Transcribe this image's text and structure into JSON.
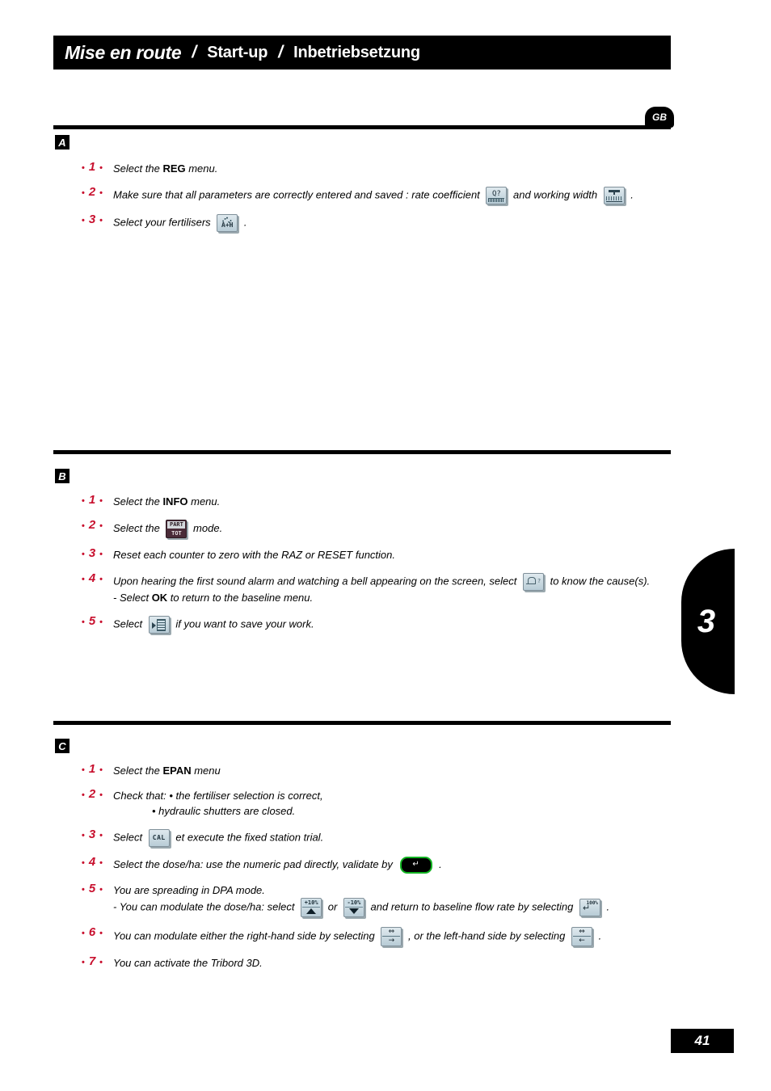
{
  "header": {
    "title_fr": "Mise en route",
    "separator": "/",
    "title_en": "Start-up",
    "title_de": "Inbetriebsetzung"
  },
  "language_badge": "GB",
  "chapter_tab": "3",
  "page_number": "41",
  "sections": [
    {
      "letter": "A",
      "steps": [
        {
          "num": "1",
          "lines": [
            {
              "parts": [
                {
                  "t": "text",
                  "v": "Select the "
                },
                {
                  "t": "bold",
                  "v": "REG"
                },
                {
                  "t": "text",
                  "v": " menu."
                }
              ]
            }
          ]
        },
        {
          "num": "2",
          "lines": [
            {
              "parts": [
                {
                  "t": "text",
                  "v": "Make sure that all parameters are correctly entered and saved : rate coefficient "
                },
                {
                  "t": "icon",
                  "v": "rate-coefficient-key"
                },
                {
                  "t": "text",
                  "v": " and working width "
                },
                {
                  "t": "icon",
                  "v": "working-width-key"
                },
                {
                  "t": "text",
                  "v": " ."
                }
              ]
            }
          ]
        },
        {
          "num": "3",
          "lines": [
            {
              "parts": [
                {
                  "t": "text",
                  "v": "Select your fertilisers "
                },
                {
                  "t": "icon",
                  "v": "fertiliser-key"
                },
                {
                  "t": "text",
                  "v": " ."
                }
              ]
            }
          ]
        }
      ]
    },
    {
      "letter": "B",
      "steps": [
        {
          "num": "1",
          "lines": [
            {
              "parts": [
                {
                  "t": "text",
                  "v": "Select the "
                },
                {
                  "t": "bold",
                  "v": "INFO"
                },
                {
                  "t": "text",
                  "v": " menu."
                }
              ]
            }
          ]
        },
        {
          "num": "2",
          "lines": [
            {
              "parts": [
                {
                  "t": "text",
                  "v": "Select the "
                },
                {
                  "t": "icon",
                  "v": "part-tot-key"
                },
                {
                  "t": "text",
                  "v": " mode."
                }
              ]
            }
          ]
        },
        {
          "num": "3",
          "lines": [
            {
              "parts": [
                {
                  "t": "text",
                  "v": "Reset each counter to zero with the RAZ or RESET function."
                }
              ]
            }
          ]
        },
        {
          "num": "4",
          "lines": [
            {
              "parts": [
                {
                  "t": "text",
                  "v": "Upon hearing the first sound alarm and watching a bell appearing on the screen, select "
                },
                {
                  "t": "icon",
                  "v": "alarm-bell-key"
                },
                {
                  "t": "text",
                  "v": " to know the cause(s)."
                }
              ]
            },
            {
              "parts": [
                {
                  "t": "text",
                  "v": "- Select "
                },
                {
                  "t": "bold",
                  "v": "OK"
                },
                {
                  "t": "text",
                  "v": " to return to the baseline menu."
                }
              ]
            }
          ]
        },
        {
          "num": "5",
          "lines": [
            {
              "parts": [
                {
                  "t": "text",
                  "v": "Select "
                },
                {
                  "t": "icon",
                  "v": "save-work-key"
                },
                {
                  "t": "text",
                  "v": " if you want to save your work."
                }
              ]
            }
          ]
        }
      ]
    },
    {
      "letter": "C",
      "steps": [
        {
          "num": "1",
          "lines": [
            {
              "parts": [
                {
                  "t": "text",
                  "v": "Select the "
                },
                {
                  "t": "bold",
                  "v": "EPAN"
                },
                {
                  "t": "text",
                  "v": " menu"
                }
              ]
            }
          ]
        },
        {
          "num": "2",
          "lines": [
            {
              "parts": [
                {
                  "t": "text",
                  "v": "Check that: • the fertiliser selection is correct,"
                }
              ]
            },
            {
              "indent": true,
              "parts": [
                {
                  "t": "text",
                  "v": "• hydraulic shutters are closed."
                }
              ]
            }
          ]
        },
        {
          "num": "3",
          "lines": [
            {
              "parts": [
                {
                  "t": "text",
                  "v": "Select "
                },
                {
                  "t": "icon",
                  "v": "cal-key"
                },
                {
                  "t": "text",
                  "v": " et execute the fixed station trial."
                }
              ]
            }
          ]
        },
        {
          "num": "4",
          "lines": [
            {
              "parts": [
                {
                  "t": "text",
                  "v": "Select the dose/ha: use the numeric pad directly, validate by "
                },
                {
                  "t": "icon",
                  "v": "validate-enter-key"
                },
                {
                  "t": "text",
                  "v": " ."
                }
              ]
            }
          ]
        },
        {
          "num": "5",
          "lines": [
            {
              "parts": [
                {
                  "t": "text",
                  "v": "You are spreading in DPA mode."
                }
              ]
            },
            {
              "parts": [
                {
                  "t": "text",
                  "v": "- You can modulate the dose/ha: select "
                },
                {
                  "t": "icon",
                  "v": "plus-10-percent-key"
                },
                {
                  "t": "text",
                  "v": " or "
                },
                {
                  "t": "icon",
                  "v": "minus-10-percent-key"
                },
                {
                  "t": "text",
                  "v": " and return to baseline flow rate by selecting "
                },
                {
                  "t": "icon",
                  "v": "return-100-percent-key"
                },
                {
                  "t": "text",
                  "v": " ."
                }
              ]
            }
          ]
        },
        {
          "num": "6",
          "lines": [
            {
              "parts": [
                {
                  "t": "text",
                  "v": "You can modulate either the right-hand side by selecting "
                },
                {
                  "t": "icon",
                  "v": "modulate-right-side-key"
                },
                {
                  "t": "text",
                  "v": " , or the left-hand side by selecting "
                },
                {
                  "t": "icon",
                  "v": "modulate-left-side-key"
                },
                {
                  "t": "text",
                  "v": " ."
                }
              ]
            }
          ]
        },
        {
          "num": "7",
          "lines": [
            {
              "parts": [
                {
                  "t": "text",
                  "v": "You can activate the Tribord 3D."
                }
              ]
            }
          ]
        }
      ]
    }
  ],
  "icons": {
    "rate-coefficient-key": {
      "label": "Q?"
    },
    "working-width-key": {
      "label": ""
    },
    "fertiliser-key": {
      "label": "A+H"
    },
    "part-tot-key": {
      "top": "PART",
      "bottom": "TOT"
    },
    "alarm-bell-key": {
      "label": "?"
    },
    "save-work-key": {
      "label": ""
    },
    "cal-key": {
      "label": "CAL"
    },
    "validate-enter-key": {
      "label": "↵"
    },
    "plus-10-percent-key": {
      "label": "+10%"
    },
    "minus-10-percent-key": {
      "label": "-10%"
    },
    "return-100-percent-key": {
      "label": "100%",
      "arrow": "↵"
    },
    "modulate-right-side-key": {
      "top": "⇔",
      "bottom": "→"
    },
    "modulate-left-side-key": {
      "top": "⇔",
      "bottom": "←"
    }
  },
  "colors": {
    "accent_red": "#c8102e",
    "bar_black": "#000000",
    "key_face": "#cfe0e8",
    "validate_green": "#12b322"
  }
}
